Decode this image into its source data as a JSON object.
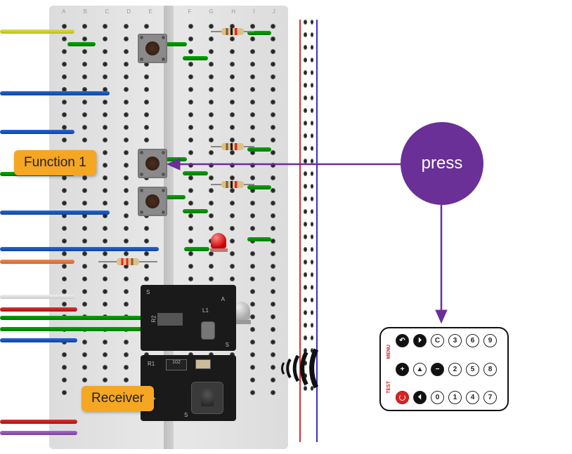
{
  "labels": {
    "function1": "Function 1",
    "receiver": "Receiver",
    "press": "press"
  },
  "breadboard": {
    "columns": [
      "A",
      "B",
      "C",
      "D",
      "E",
      "F",
      "G",
      "H",
      "I",
      "J"
    ]
  },
  "module_top": {
    "silk": [
      "S",
      "R2",
      "L1",
      "A",
      "S"
    ]
  },
  "module_bottom": {
    "silk": [
      "R1",
      "102",
      "S"
    ]
  },
  "remote": {
    "side_labels": [
      "MENU",
      "TEST"
    ],
    "rows": [
      [
        "↶",
        "⏵",
        "C",
        "3",
        "6",
        "9"
      ],
      [
        "+",
        "▲",
        "−",
        "2",
        "5",
        "8"
      ],
      [
        "⏻",
        "⏴",
        "0",
        "1",
        "4",
        "7"
      ]
    ],
    "black_keys": [
      "↶",
      "⏵",
      "+",
      "−",
      "⏴"
    ],
    "power_key": "⏻"
  }
}
